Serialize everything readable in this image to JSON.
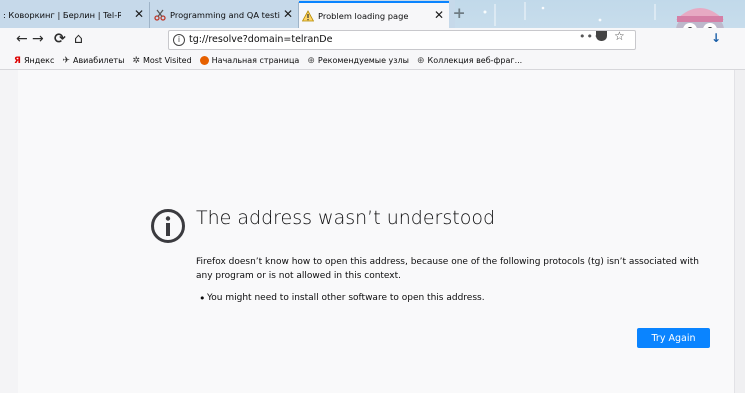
{
  "tabs": [
    {
      "label": ": Коворкинг | Берлин | Tel-Ran",
      "active": false,
      "icon": "globe-icon"
    },
    {
      "label": "Programming and QA testing c",
      "active": false,
      "icon": "scissors-icon"
    },
    {
      "label": "Problem loading page",
      "active": true,
      "icon": "warning-icon"
    }
  ],
  "newtab_label": "+",
  "tab_close_glyph": "✕",
  "nav": {
    "back": "←",
    "forward": "→",
    "reload": "⟳",
    "home": "⌂",
    "url": "tg://resolve?domain=telranDe",
    "page_actions": "•••"
  },
  "bookmarks": [
    {
      "label": "Яндекс",
      "icon": "yandex-icon"
    },
    {
      "label": "Авиабилеты",
      "icon": "plane-icon"
    },
    {
      "label": "Most Visited",
      "icon": "gear-icon"
    },
    {
      "label": "Начальная страница",
      "icon": "firefox-icon"
    },
    {
      "label": "Рекомендуемые узлы",
      "icon": "globe-icon"
    },
    {
      "label": "Коллекция веб-фраг...",
      "icon": "globe-icon"
    }
  ],
  "error": {
    "title": "The address wasn’t understood",
    "description": "Firefox doesn’t know how to open this address, because one of the following protocols (tg) isn’t associated with any program or is not allowed in this context.",
    "bullet": "You might need to install other software to open this address.",
    "button": "Try Again"
  },
  "colors": {
    "accent": "#0a84ff",
    "tabstrip": "#c6d9ea",
    "toolbar": "#f7f7f9",
    "page_bg": "#f9f9fa"
  }
}
